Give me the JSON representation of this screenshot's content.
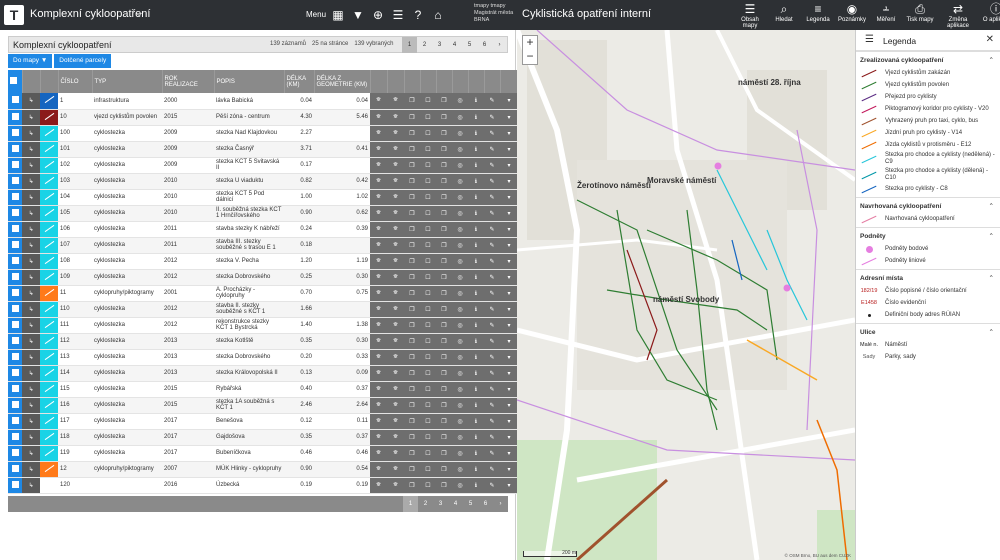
{
  "header": {
    "app_title": "Komplexní cykloopatření",
    "menu_label": "Menu",
    "municipality_line1": "tmapy tmapy",
    "municipality_line2": "Magistrát města",
    "municipality_line3": "BRNA",
    "map_title": "Cyklistická opatření interní",
    "tools": [
      {
        "label": "Obsah mapy",
        "icon": "layers-icon"
      },
      {
        "label": "Hledat",
        "icon": "search-icon"
      },
      {
        "label": "Legenda",
        "icon": "legend-icon"
      },
      {
        "label": "Poznámky",
        "icon": "note-pin-icon"
      },
      {
        "label": "Měření",
        "icon": "ruler-icon"
      },
      {
        "label": "Tisk mapy",
        "icon": "print-icon"
      },
      {
        "label": "Změna aplikace",
        "icon": "switch-app-icon"
      },
      {
        "label": "O aplikaci",
        "icon": "info-icon"
      }
    ]
  },
  "panel": {
    "title": "Komplexní cykloopatření",
    "records": "139 záznamů",
    "per_page": "25 na stránce",
    "selected": "139 vybraných",
    "pages": [
      "1",
      "2",
      "3",
      "4",
      "5",
      "6"
    ],
    "btn_map": "Do mapy",
    "btn_parcels": "Dotčené parcely"
  },
  "table": {
    "columns": [
      "ČÍSLO",
      "TYP",
      "ROK REALIZACE",
      "POPIS",
      "DÉLKA (KM)",
      "DÉLKA Z GEOMETRIE (KM)"
    ],
    "rows": [
      {
        "cislo": "1",
        "typ": "infrastruktura",
        "rok": "2000",
        "popis": "lávka Babická",
        "delka": "0.04",
        "geom": "0.04",
        "color": "#1565c0"
      },
      {
        "cislo": "10",
        "typ": "vjezd cyklistům povolen",
        "rok": "2015",
        "popis": "Pěší zóna - centrum",
        "delka": "4.30",
        "geom": "5.46",
        "color": "#8b1a1a"
      },
      {
        "cislo": "100",
        "typ": "cyklostezka",
        "rok": "2009",
        "popis": "stezka Nad Klajdovkou",
        "delka": "2.27",
        "geom": "",
        "color": "#19d3e6"
      },
      {
        "cislo": "101",
        "typ": "cyklostezka",
        "rok": "2009",
        "popis": "stezka Časnýř",
        "delka": "3.71",
        "geom": "0.41",
        "color": "#19d3e6"
      },
      {
        "cislo": "102",
        "typ": "cyklostezka",
        "rok": "2009",
        "popis": "stezka KČT 5 Svitavská II",
        "delka": "0.17",
        "geom": "",
        "color": "#19d3e6"
      },
      {
        "cislo": "103",
        "typ": "cyklostezka",
        "rok": "2010",
        "popis": "stezka U viaduktu",
        "delka": "0.82",
        "geom": "0.42",
        "color": "#19d3e6"
      },
      {
        "cislo": "104",
        "typ": "cyklostezka",
        "rok": "2010",
        "popis": "stezka KČT 5 Pod dálnicí",
        "delka": "1.00",
        "geom": "1.02",
        "color": "#19d3e6"
      },
      {
        "cislo": "105",
        "typ": "cyklostezka",
        "rok": "2010",
        "popis": "II. souběžná stezka KČT 1 Hrnčířovského",
        "delka": "0.90",
        "geom": "0.62",
        "color": "#19d3e6"
      },
      {
        "cislo": "106",
        "typ": "cyklostezka",
        "rok": "2011",
        "popis": "stavba stezky K nábřeží",
        "delka": "0.24",
        "geom": "0.39",
        "color": "#19d3e6"
      },
      {
        "cislo": "107",
        "typ": "cyklostezka",
        "rok": "2011",
        "popis": "stavba III. stezky souběžné s trasou E 1",
        "delka": "0.18",
        "geom": "",
        "color": "#19d3e6"
      },
      {
        "cislo": "108",
        "typ": "cyklostezka",
        "rok": "2012",
        "popis": "stezka V. Pecha",
        "delka": "1.20",
        "geom": "1.19",
        "color": "#19d3e6"
      },
      {
        "cislo": "109",
        "typ": "cyklostezka",
        "rok": "2012",
        "popis": "stezka Dobrovského",
        "delka": "0.25",
        "geom": "0.30",
        "color": "#19d3e6"
      },
      {
        "cislo": "11",
        "typ": "cyklopruhy/piktogramy",
        "rok": "2001",
        "popis": "A. Procházky - cyklopruhy",
        "delka": "0.70",
        "geom": "0.75",
        "color": "#ff7a1a"
      },
      {
        "cislo": "110",
        "typ": "cyklostezka",
        "rok": "2012",
        "popis": "stavba II. stezky souběžné s KČT 1",
        "delka": "1.66",
        "geom": "",
        "color": "#19d3e6"
      },
      {
        "cislo": "111",
        "typ": "cyklostezka",
        "rok": "2012",
        "popis": "rekonstrukce stezky KČT 1 Bystrcká",
        "delka": "1.40",
        "geom": "1.38",
        "color": "#19d3e6"
      },
      {
        "cislo": "112",
        "typ": "cyklostezka",
        "rok": "2013",
        "popis": "stezka Kotlště",
        "delka": "0.35",
        "geom": "0.30",
        "color": "#19d3e6"
      },
      {
        "cislo": "113",
        "typ": "cyklostezka",
        "rok": "2013",
        "popis": "stezka Dobrovského",
        "delka": "0.20",
        "geom": "0.33",
        "color": "#19d3e6"
      },
      {
        "cislo": "114",
        "typ": "cyklostezka",
        "rok": "2013",
        "popis": "stezka Královopolská II",
        "delka": "0.13",
        "geom": "0.09",
        "color": "#19d3e6"
      },
      {
        "cislo": "115",
        "typ": "cyklostezka",
        "rok": "2015",
        "popis": "Rybářská",
        "delka": "0.40",
        "geom": "0.37",
        "color": "#19d3e6"
      },
      {
        "cislo": "116",
        "typ": "cyklostezka",
        "rok": "2015",
        "popis": "stezka 1A souběžná s KČT 1",
        "delka": "2.46",
        "geom": "2.64",
        "color": "#19d3e6"
      },
      {
        "cislo": "117",
        "typ": "cyklostezka",
        "rok": "2017",
        "popis": "Benešova",
        "delka": "0.12",
        "geom": "0.11",
        "color": "#19d3e6"
      },
      {
        "cislo": "118",
        "typ": "cyklostezka",
        "rok": "2017",
        "popis": "Gajdošova",
        "delka": "0.35",
        "geom": "0.37",
        "color": "#19d3e6"
      },
      {
        "cislo": "119",
        "typ": "cyklostezka",
        "rok": "2017",
        "popis": "Bubeníčkova",
        "delka": "0.46",
        "geom": "0.46",
        "color": "#19d3e6"
      },
      {
        "cislo": "12",
        "typ": "cyklopruhy/piktogramy",
        "rok": "2007",
        "popis": "MÚK Hlinky - cyklopruhy",
        "delka": "0.90",
        "geom": "0.54",
        "color": "#ff7a1a"
      },
      {
        "cislo": "120",
        "typ": "",
        "rok": "2016",
        "popis": "Úzbecká",
        "delka": "0.19",
        "geom": "0.19",
        "color": "#ffffff"
      }
    ]
  },
  "map": {
    "labels": [
      {
        "text": "náměstí 28. října",
        "id": "label-28-rijna"
      },
      {
        "text": "Žerotínovo náměstí",
        "id": "label-zerotinovo"
      },
      {
        "text": "Moravské náměstí",
        "id": "label-moravske"
      },
      {
        "text": "náměstí Svobody",
        "id": "label-svobody"
      }
    ],
    "scale_label": "200 m",
    "attribution": "© OSM Brno, BU aus dem CUZK"
  },
  "legend": {
    "title": "Legenda",
    "sections": [
      {
        "title": "Zrealizovaná cykloopatření",
        "items": [
          {
            "label": "Vjezd cyklistům zakázán",
            "color": "#8b1a1a"
          },
          {
            "label": "Vjezd cyklistům povolen",
            "color": "#2e7d32"
          },
          {
            "label": "Přejezd pro cyklisty",
            "color": "#5b2c83"
          },
          {
            "label": "Piktogramový koridor pro cyklisty - V20",
            "color": "#c2185b"
          },
          {
            "label": "Vyhrazený pruh pro taxi, cyklo, bus",
            "color": "#a0522d"
          },
          {
            "label": "Jízdní pruh pro cyklisty - V14",
            "color": "#f9a825"
          },
          {
            "label": "Jízda cyklistů v protisměru - E12",
            "color": "#ef6c00"
          },
          {
            "label": "Stezka pro chodce a cyklisty (nedělená) - C9",
            "color": "#26c6da"
          },
          {
            "label": "Stezka pro chodce a cyklisty (dělená) - C10",
            "color": "#0097a7"
          },
          {
            "label": "Stezka pro cyklisty - C8",
            "color": "#1565c0"
          }
        ]
      },
      {
        "title": "Navrhovaná cykloopatření",
        "items": [
          {
            "label": "Navrhovaná cykloopatření",
            "color": "#e57ea4"
          }
        ]
      },
      {
        "title": "Podněty",
        "items": [
          {
            "label": "Podněty bodové",
            "color": "#e57ee0",
            "kind": "dot"
          },
          {
            "label": "Podněty liniové",
            "color": "#e57ee0"
          }
        ]
      },
      {
        "title": "Adresní místa",
        "items": [
          {
            "label": "Číslo popisné / číslo orientační",
            "sym": "182/19",
            "color": "#b71c1c",
            "kind": "text"
          },
          {
            "label": "Číslo evidenční",
            "sym": "E1458",
            "color": "#b71c1c",
            "kind": "text"
          },
          {
            "label": "Definiční body adres RÚIAN",
            "color": "#222",
            "kind": "smalldot"
          }
        ]
      },
      {
        "title": "Ulice",
        "items": [
          {
            "label": "Náměstí",
            "sym": "Malé n.",
            "color": "#222",
            "kind": "text"
          },
          {
            "label": "Parky, sady",
            "sym": "Sady",
            "color": "#555",
            "kind": "text"
          }
        ]
      }
    ]
  }
}
